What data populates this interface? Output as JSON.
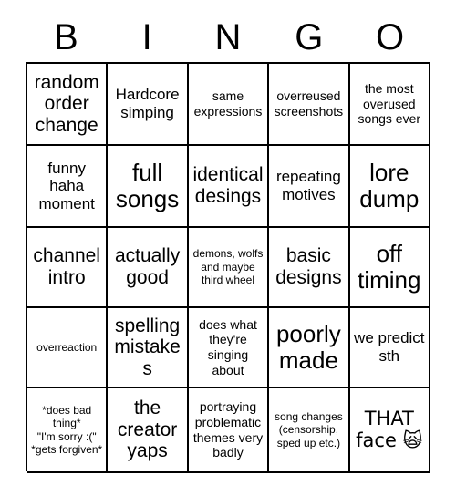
{
  "header": {
    "letters": [
      "B",
      "I",
      "N",
      "G",
      "O"
    ]
  },
  "colors": {
    "background": "#ffffff",
    "grid_line": "#000000",
    "text": "#000000"
  },
  "grid": {
    "rows": 5,
    "columns": 5,
    "cells": [
      {
        "text": "random order change",
        "size": "fs-lg"
      },
      {
        "text": "Hardcore simping",
        "size": "fs-md"
      },
      {
        "text": "same expressions",
        "size": "fs-sm"
      },
      {
        "text": "overreused screenshots",
        "size": "fs-sm"
      },
      {
        "text": "the most overused songs ever",
        "size": "fs-sm"
      },
      {
        "text": "funny haha moment",
        "size": "fs-md"
      },
      {
        "text": "full songs",
        "size": "fs-xl"
      },
      {
        "text": "identical desings",
        "size": "fs-lg"
      },
      {
        "text": "repeating motives",
        "size": "fs-md"
      },
      {
        "text": "lore dump",
        "size": "fs-xl"
      },
      {
        "text": "channel intro",
        "size": "fs-lg"
      },
      {
        "text": "actually good",
        "size": "fs-lg"
      },
      {
        "text": "demons, wolfs and maybe third wheel",
        "size": "fs-xs"
      },
      {
        "text": "basic designs",
        "size": "fs-lg"
      },
      {
        "text": "off timing",
        "size": "fs-xl"
      },
      {
        "text": "overreaction",
        "size": "fs-xs"
      },
      {
        "text": "spelling mistakes",
        "size": "fs-lg"
      },
      {
        "text": "does what they're singing about",
        "size": "fs-sm"
      },
      {
        "text": "poorly made",
        "size": "fs-xl"
      },
      {
        "text": "we predict sth",
        "size": "fs-md"
      },
      {
        "text": "*does bad thing*\n\"I'm sorry :(\"\n*gets forgiven*",
        "size": "fs-xs"
      },
      {
        "text": "the creator yaps",
        "size": "fs-lg"
      },
      {
        "text": "portraying problematic themes very badly",
        "size": "fs-sm"
      },
      {
        "text": "song changes (censorship, sped up etc.)",
        "size": "fs-xs"
      },
      {
        "text": "THAT face 🙀",
        "size": "fs-lg"
      }
    ]
  }
}
